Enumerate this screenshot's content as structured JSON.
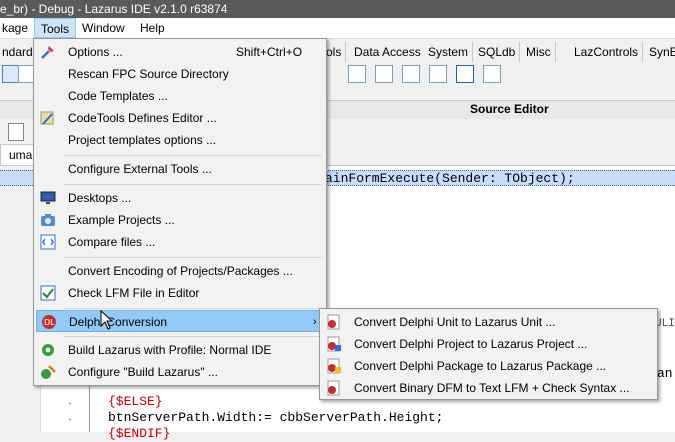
{
  "window": {
    "title": "e_br) - Debug - Lazarus IDE v2.1.0 r63874"
  },
  "menubar": {
    "items": [
      "kage",
      "Tools",
      "Window",
      "Help"
    ],
    "active": "Tools"
  },
  "component_tabs": [
    "ndard",
    "ols",
    "Data Access",
    "System",
    "SQLdb",
    "Misc",
    "LazControls",
    "SynE"
  ],
  "source_editor": {
    "title": "Source Editor",
    "tab_label": "uma"
  },
  "code": {
    "highlight_line": "ainFormExecute(Sender: TObject);",
    "right_fragments": [
      "ULI",
      "an"
    ],
    "lines": [
      "{$ELSE}",
      "btnServerPath.Width:= cbbServerPath.Height;",
      "{$ENDIF}"
    ]
  },
  "tools_menu": {
    "items": [
      {
        "label": "Options ...",
        "shortcut": "Shift+Ctrl+O",
        "icon": "tools-icon"
      },
      {
        "label": "Rescan FPC Source Directory",
        "icon": ""
      },
      {
        "label": "Code Templates ...",
        "icon": ""
      },
      {
        "label": "CodeTools Defines Editor ...",
        "icon": "codetools-icon"
      },
      {
        "label": "Project templates options ...",
        "icon": ""
      },
      {
        "label": "Configure External Tools ...",
        "icon": ""
      },
      {
        "label": "Desktops ...",
        "icon": "monitor-icon"
      },
      {
        "label": "Example Projects ...",
        "icon": "camera-icon"
      },
      {
        "label": "Compare files ...",
        "icon": "compare-icon"
      },
      {
        "label": "Convert Encoding of Projects/Packages ...",
        "icon": ""
      },
      {
        "label": "Check LFM File in Editor",
        "icon": "check-icon"
      },
      {
        "label": "Delphi Conversion",
        "icon": "delphi-icon",
        "submenu": true
      },
      {
        "label": "Build Lazarus with Profile: Normal IDE",
        "icon": "gear-icon"
      },
      {
        "label": "Configure \"Build Lazarus\" ...",
        "icon": "build-config-icon"
      }
    ]
  },
  "delphi_submenu": {
    "items": [
      {
        "label": "Convert Delphi Unit to Lazarus Unit ..."
      },
      {
        "label": "Convert Delphi Project to Lazarus Project ..."
      },
      {
        "label": "Convert Delphi Package to Lazarus Package ..."
      },
      {
        "label": "Convert Binary DFM to Text LFM + Check Syntax ..."
      }
    ]
  },
  "colors": {
    "menu_highlight": "#91c9f7",
    "editor_highlight": "#c8dcfb",
    "titlebar": "#5a5a5a"
  }
}
